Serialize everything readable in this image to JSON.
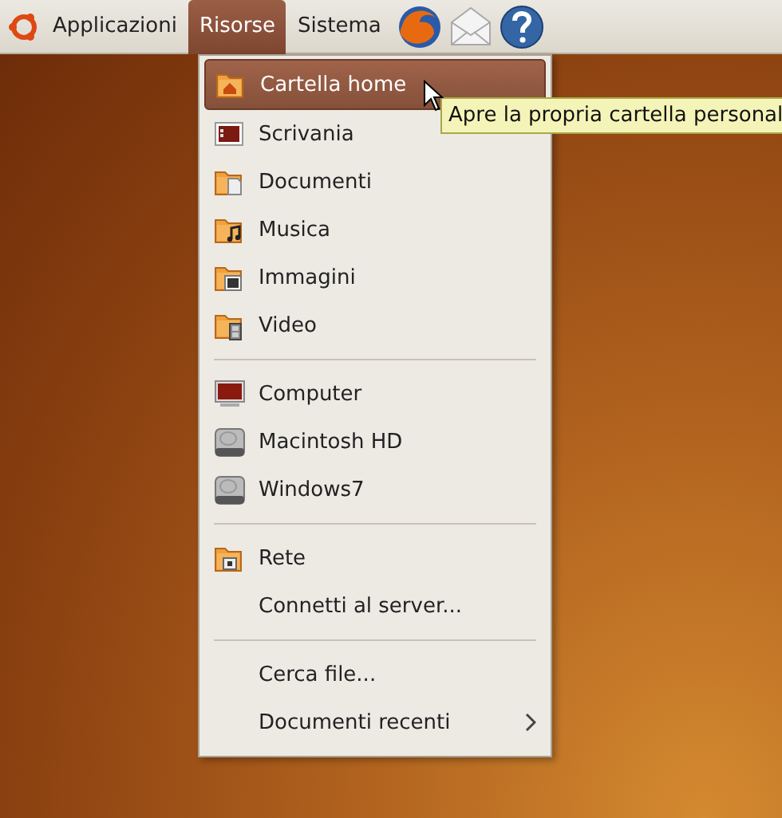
{
  "top_panel": {
    "menus": [
      {
        "label": "Applicazioni",
        "selected": false
      },
      {
        "label": "Risorse",
        "selected": true
      },
      {
        "label": "Sistema",
        "selected": false
      }
    ]
  },
  "menu": {
    "sections": [
      {
        "items": [
          {
            "label": "Cartella home",
            "kind": "home",
            "selected": true,
            "has_submenu": false
          },
          {
            "label": "Scrivania",
            "kind": "desktop",
            "selected": false,
            "has_submenu": false
          },
          {
            "label": "Documenti",
            "kind": "documents",
            "selected": false,
            "has_submenu": false
          },
          {
            "label": "Musica",
            "kind": "music",
            "selected": false,
            "has_submenu": false
          },
          {
            "label": "Immagini",
            "kind": "pictures",
            "selected": false,
            "has_submenu": false
          },
          {
            "label": "Video",
            "kind": "videos",
            "selected": false,
            "has_submenu": false
          }
        ]
      },
      {
        "items": [
          {
            "label": "Computer",
            "kind": "computer",
            "selected": false,
            "has_submenu": false
          },
          {
            "label": "Macintosh HD",
            "kind": "drive",
            "selected": false,
            "has_submenu": false
          },
          {
            "label": "Windows7",
            "kind": "drive",
            "selected": false,
            "has_submenu": false
          }
        ]
      },
      {
        "items": [
          {
            "label": "Rete",
            "kind": "network",
            "selected": false,
            "has_submenu": false
          },
          {
            "label": "Connetti al server...",
            "kind": "action",
            "selected": false,
            "has_submenu": false
          }
        ]
      },
      {
        "items": [
          {
            "label": "Cerca file...",
            "kind": "action",
            "selected": false,
            "has_submenu": false
          },
          {
            "label": "Documenti recenti",
            "kind": "action",
            "selected": false,
            "has_submenu": true
          }
        ]
      }
    ]
  },
  "tooltip": {
    "text": "Apre la propria cartella personal"
  }
}
